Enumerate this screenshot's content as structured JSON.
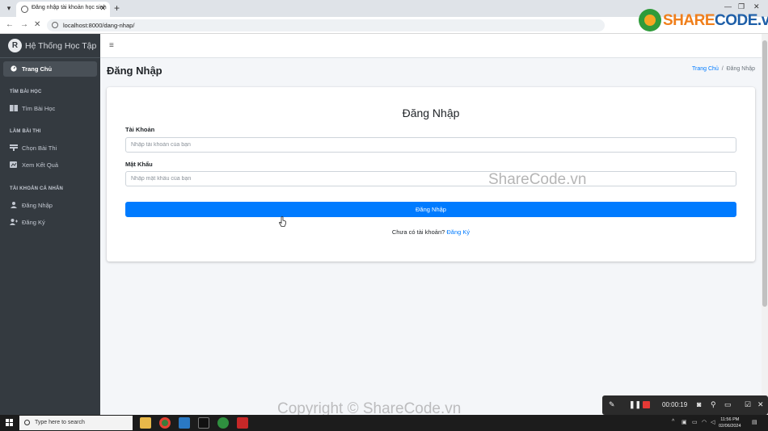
{
  "browser": {
    "tab_title": "Đăng nhập tài khoản học sinh",
    "url": "localhost:8000/dang-nhap/",
    "watermark_brand_a": "SHARE",
    "watermark_brand_b": "CODE.vn"
  },
  "sidebar": {
    "brand": "Hệ Thống Học Tập",
    "home": "Trang Chủ",
    "sections": [
      {
        "header": "TÌM BÀI HỌC",
        "items": [
          {
            "label": "Tìm Bài Học",
            "icon": "book-icon"
          }
        ]
      },
      {
        "header": "LÀM BÀI THI",
        "items": [
          {
            "label": "Chọn Bài Thi",
            "icon": "list-icon"
          },
          {
            "label": "Xem Kết Quả",
            "icon": "chart-icon"
          }
        ]
      },
      {
        "header": "TÀI KHOẢN CÁ NHÂN",
        "items": [
          {
            "label": "Đăng Nhập",
            "icon": "user-icon"
          },
          {
            "label": "Đăng Ký",
            "icon": "user-plus-icon"
          }
        ]
      }
    ]
  },
  "topbar": {
    "menu_icon": "≡"
  },
  "page": {
    "title": "Đăng Nhập",
    "breadcrumb_home": "Trang Chủ",
    "breadcrumb_sep": "/",
    "breadcrumb_current": "Đăng Nhập"
  },
  "form": {
    "title": "Đăng Nhập",
    "username_label": "Tài Khoản",
    "username_placeholder": "Nhập tài khoản của bạn",
    "password_label": "Mật Khẩu",
    "password_placeholder": "Nhập mật khẩu của bạn",
    "submit_label": "Đăng Nhập",
    "register_prompt": "Chưa có tài khoản?",
    "register_link": "Đăng Ký"
  },
  "watermarks": {
    "center": "ShareCode.vn",
    "bottom": "Copyright © ShareCode.vn"
  },
  "recorder": {
    "timer": "00:00:19"
  },
  "taskbar": {
    "search_placeholder": "Type here to search",
    "time": "11:56 PM",
    "date": "02/06/2024"
  },
  "colors": {
    "primary": "#007bff",
    "sidebar": "#343a40",
    "content_bg": "#f4f6f9"
  }
}
